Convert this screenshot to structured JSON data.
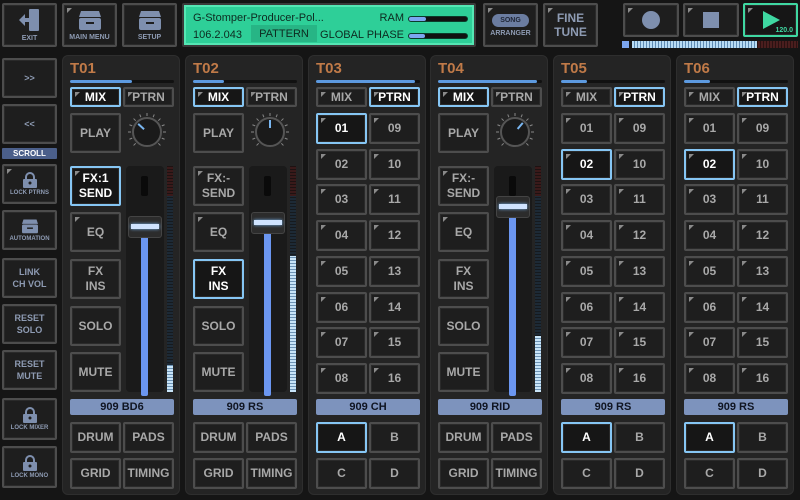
{
  "top": {
    "exit_label": "EXIT",
    "main_menu_label": "MAIN MENU",
    "setup_label": "SETUP",
    "arranger_label": "ARRANGER",
    "song_badge": "SONG",
    "fine_tune_label": "FINE\nTUNE",
    "tempo": "120.0",
    "lcd": {
      "title": "G-Stomper-Producer-Pol...",
      "version": "106.2.043",
      "mode": "PATTERN",
      "ram_label": "RAM",
      "ram_level": 0.3,
      "phase_label": "GLOBAL PHASE",
      "phase_level": 0.27
    },
    "sequence_progress": 0.75
  },
  "sidebar": {
    "forward_label": ">>",
    "back_label": "<<",
    "scroll_label": "SCROLL",
    "lock_ptrns_label": "LOCK PTRNS",
    "automation_label": "AUTOMATION",
    "link_ch_vol_label": "LINK\nCH VOL",
    "reset_solo_label": "RESET\nSOLO",
    "reset_mute_label": "RESET\nMUTE",
    "lock_mixer_label": "LOCK MIXER",
    "lock_mono_label": "LOCK MONO"
  },
  "common": {
    "mix": "MIX",
    "ptrn": "PTRN",
    "play": "PLAY",
    "eq": "EQ",
    "fx_ins": "FX\nINS",
    "solo": "SOLO",
    "mute": "MUTE",
    "drum": "DRUM",
    "pads": "PADS",
    "grid": "GRID",
    "timing": "TIMING",
    "banks": [
      "A",
      "B",
      "C",
      "D"
    ],
    "patterns_left": [
      "01",
      "02",
      "03",
      "04",
      "05",
      "06",
      "07",
      "08"
    ],
    "patterns_right": [
      "09",
      "10",
      "11",
      "12",
      "13",
      "14",
      "15",
      "16"
    ]
  },
  "tracks": [
    {
      "id": "T01",
      "mode": "mix",
      "progress": 0.6,
      "fx_send": "FX:1\nSEND",
      "fx_send_active": true,
      "fx_ins_active": false,
      "pan": -0.35,
      "fader": 0.8,
      "meter": 0.12,
      "instrument": "909 BD6"
    },
    {
      "id": "T02",
      "mode": "mix",
      "progress": 0.3,
      "fx_send": "FX:-\nSEND",
      "fx_send_active": false,
      "fx_ins_active": true,
      "pan": 0.0,
      "fader": 0.82,
      "meter": 0.6,
      "instrument": "909 RS"
    },
    {
      "id": "T03",
      "mode": "ptrn",
      "progress": 0.95,
      "selected_pattern": "01",
      "bank": "A",
      "instrument": "909 CH"
    },
    {
      "id": "T04",
      "mode": "mix",
      "progress": 0.95,
      "fx_send": "FX:-\nSEND",
      "fx_send_active": false,
      "fx_ins_active": false,
      "pan": 0.3,
      "fader": 0.9,
      "meter": 0.25,
      "instrument": "909 RID"
    },
    {
      "id": "T05",
      "mode": "ptrn",
      "progress": 0.25,
      "selected_pattern": "02",
      "bank": "A",
      "instrument": "909 RS"
    },
    {
      "id": "T06",
      "mode": "ptrn",
      "progress": 0.25,
      "selected_pattern": "02",
      "bank": "A",
      "instrument": "909 RS"
    }
  ]
}
